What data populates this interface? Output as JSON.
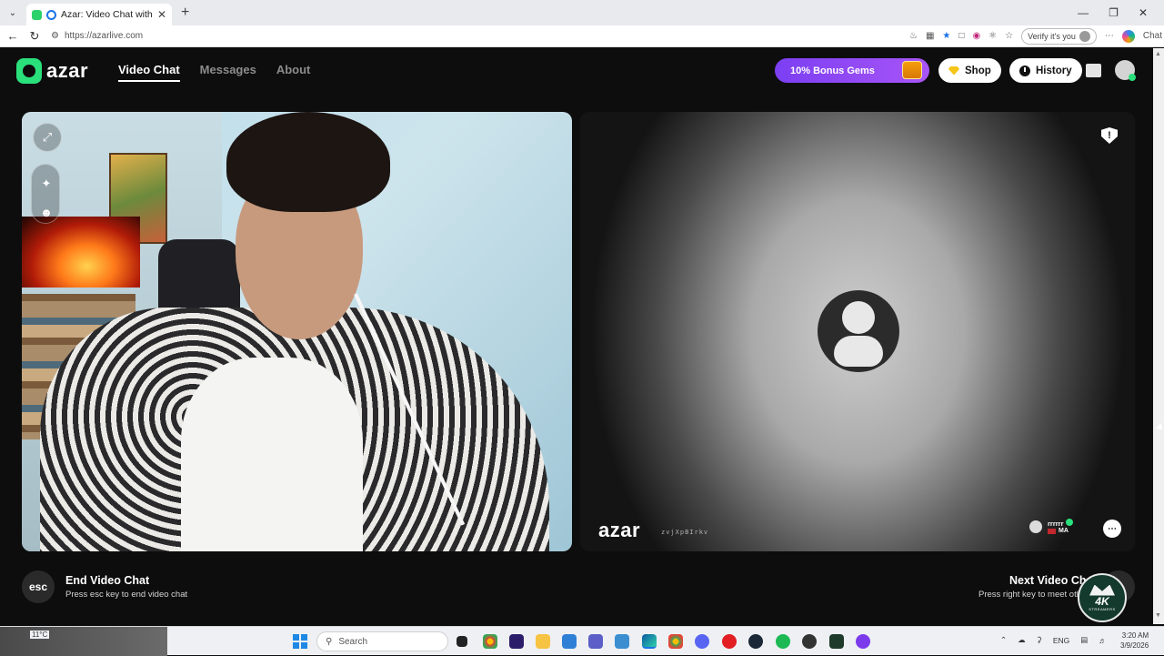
{
  "browser": {
    "tab_title": "Azar: Video Chat with New Pe",
    "url": "https://azarlive.com",
    "verify_label": "Verify it's you",
    "chat_label": "Chat"
  },
  "nav": {
    "logo": "azar",
    "links": [
      {
        "label": "Video Chat",
        "active": true
      },
      {
        "label": "Messages",
        "active": false
      },
      {
        "label": "About",
        "active": false
      }
    ],
    "bonus_label": "10% Bonus Gems",
    "shop_label": "Shop",
    "history_label": "History"
  },
  "remote": {
    "logo": "azar",
    "id_text": "zvjXpBIrkv",
    "partner_name": "rrrrrr",
    "partner_country": "MA"
  },
  "controls": {
    "end_key": "esc",
    "end_title": "End Video Chat",
    "end_hint": "Press esc key to end video chat",
    "next_title": "Next Video Chat",
    "next_hint": "Press right key to meet other"
  },
  "watermark": {
    "text": "4K",
    "sub": "STREAMERS"
  },
  "taskbar": {
    "temperature": "11°C",
    "search_placeholder": "Search",
    "language": "ENG",
    "time": "3:20 AM",
    "date": "3/9/2026"
  },
  "colors": {
    "brand_green": "#2ae07b",
    "bonus_purple": "#8b45f5",
    "background": "#0d0d0d"
  }
}
